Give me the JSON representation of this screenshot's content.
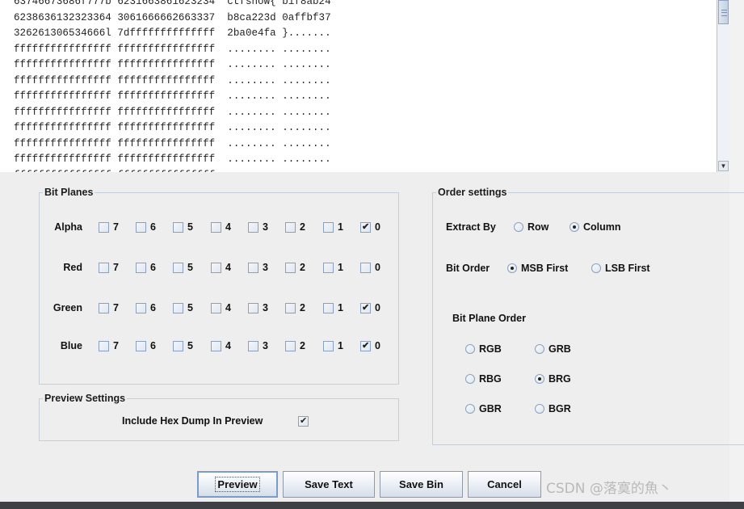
{
  "hex_preview": {
    "lines": [
      "63746673686f777b 6231663861623234  ctfshow{ b1f8ab24",
      "6238636132323364 3061666662663337  b8ca223d 0affbf37",
      "326261306534666l 7dffffffffffffff  2ba0e4fa }.......",
      "ffffffffffffffff ffffffffffffffff  ........ ........",
      "ffffffffffffffff ffffffffffffffff  ........ ........",
      "ffffffffffffffff ffffffffffffffff  ........ ........",
      "ffffffffffffffff ffffffffffffffff  ........ ........",
      "ffffffffffffffff ffffffffffffffff  ........ ........",
      "ffffffffffffffff ffffffffffffffff  ........ ........",
      "ffffffffffffffff ffffffffffffffff  ........ ........",
      "ffffffffffffffff ffffffffffffffff  ........ ........",
      "ffffffffffffffff ffffffffffffffff"
    ]
  },
  "bit_planes": {
    "title": "Bit Planes",
    "bits": [
      "7",
      "6",
      "5",
      "4",
      "3",
      "2",
      "1",
      "0"
    ],
    "rows": [
      {
        "label": "Alpha",
        "checked": [
          false,
          false,
          false,
          false,
          false,
          false,
          false,
          true
        ]
      },
      {
        "label": "Red",
        "checked": [
          false,
          false,
          false,
          false,
          false,
          false,
          false,
          false
        ]
      },
      {
        "label": "Green",
        "checked": [
          false,
          false,
          false,
          false,
          false,
          false,
          false,
          true
        ]
      },
      {
        "label": "Blue",
        "checked": [
          false,
          false,
          false,
          false,
          false,
          false,
          false,
          true
        ]
      }
    ]
  },
  "preview_settings": {
    "title": "Preview Settings",
    "include_hex_label": "Include Hex Dump In Preview",
    "include_hex_checked": true
  },
  "order_settings": {
    "title": "Order settings",
    "extract_by_label": "Extract By",
    "extract_row": "Row",
    "extract_column": "Column",
    "extract_selected": "Column",
    "bit_order_label": "Bit Order",
    "msb_first": "MSB First",
    "lsb_first": "LSB First",
    "bit_order_selected": "MSB First",
    "bit_plane_order_label": "Bit Plane Order",
    "plane_orders": [
      "RGB",
      "GRB",
      "RBG",
      "BRG",
      "GBR",
      "BGR"
    ],
    "plane_order_selected": "BRG"
  },
  "buttons": {
    "preview": "Preview",
    "save_text": "Save Text",
    "save_bin": "Save Bin",
    "cancel": "Cancel"
  },
  "watermark": "CSDN @落寞的魚丶"
}
